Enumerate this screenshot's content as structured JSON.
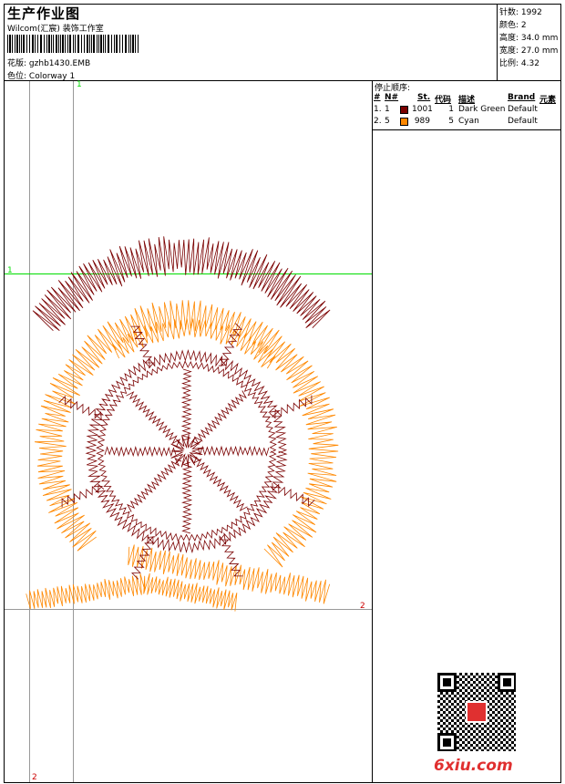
{
  "header": {
    "title": "生产作业图",
    "company": "Wilcom(汇宸) 装饰工作室",
    "design_label": "花版:",
    "design_value": "gzhb1430.EMB",
    "colorway_label": "色位:",
    "colorway_value": "Colorway 1"
  },
  "stats": [
    {
      "label": "针数:",
      "value": "1992"
    },
    {
      "label": "颜色:",
      "value": "2"
    },
    {
      "label": "高度:",
      "value": "34.0 mm"
    },
    {
      "label": "宽度:",
      "value": "27.0 mm"
    },
    {
      "label": "比例:",
      "value": "4.32"
    }
  ],
  "stop_sequence": {
    "title": "停止顺序:",
    "headers": [
      "#",
      "N#",
      "St.",
      "代码",
      "描述",
      "Brand",
      "元素"
    ],
    "rows": [
      {
        "num": "1.",
        "n": "1",
        "color": "#7a0000",
        "st": "1001",
        "code": "1",
        "desc": "Dark Green",
        "brand": "Default"
      },
      {
        "num": "2.",
        "n": "5",
        "color": "#ff8800",
        "st": "989",
        "code": "5",
        "desc": "Cyan",
        "brand": "Default"
      }
    ]
  },
  "guides": {
    "h1": "1",
    "v1": "1",
    "h2": "2",
    "v2": "2"
  },
  "colors": {
    "guide_green": "#00dd00",
    "guide_gray": "#999999",
    "guide_label_red": "#cc0000",
    "thread_dark": "#7a0000",
    "thread_orange": "#ff8800"
  },
  "watermark": "6xiu.com"
}
